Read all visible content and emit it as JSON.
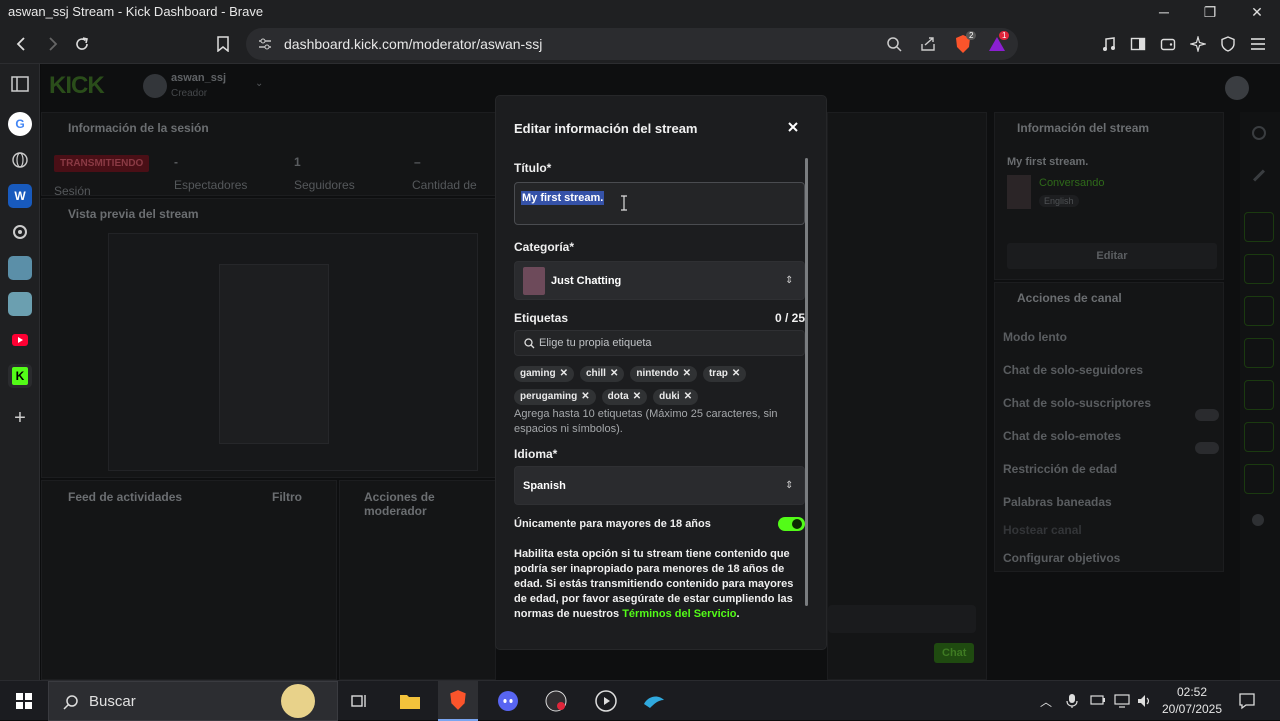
{
  "window": {
    "title": "aswan_ssj Stream - Kick Dashboard - Brave",
    "controls": [
      "─",
      "❐",
      "✕"
    ]
  },
  "browser": {
    "url": "dashboard.kick.com/moderator/aswan-ssj",
    "brave_shield_count": "2",
    "rewards_count": "1"
  },
  "page": {
    "logo": "KICK",
    "user": {
      "name": "aswan_ssj",
      "role": "Creador"
    },
    "session_panel": {
      "title": "Información de la sesión",
      "status": "TRANSMITIENDO",
      "stats": [
        {
          "value": "-",
          "label": "Sesión"
        },
        {
          "value": "-",
          "label": "Espectadores"
        },
        {
          "value": "1",
          "label": "Seguidores"
        },
        {
          "value": "–",
          "label": "Cantidad de"
        }
      ]
    },
    "preview_panel": {
      "title": "Vista previa del stream"
    },
    "activity_panel": {
      "title": "Feed de actividades",
      "filter": "Filtro"
    },
    "mod_actions_panel": {
      "title": "Acciones de moderador"
    },
    "stream_info_panel": {
      "title": "Información del stream",
      "stream_title": "My first stream.",
      "category": "Conversando",
      "language": "English",
      "edit_button": "Editar"
    },
    "channel_actions_panel": {
      "title": "Acciones de canal",
      "items": [
        "Modo lento",
        "Chat de solo-seguidores",
        "Chat de solo-suscriptores",
        "Chat de solo-emotes",
        "Restricción de edad",
        "Palabras baneadas",
        "Hostear canal",
        "Configurar objetivos"
      ]
    },
    "chat": {
      "send_button": "Chat"
    }
  },
  "modal": {
    "title": "Editar información del stream",
    "title_label": "Título*",
    "title_value": "My first stream.",
    "category_label": "Categoría*",
    "category_value": "Just Chatting",
    "tags_label": "Etiquetas",
    "tags_count": "0 / 25",
    "tags_placeholder": "Elige tu propia etiqueta",
    "tags": [
      "gaming",
      "chill",
      "nintendo",
      "trap",
      "perugaming",
      "dota",
      "duki"
    ],
    "tags_help": "Agrega hasta 10 etiquetas (Máximo 25 caracteres, sin espacios ni símbolos).",
    "language_label": "Idioma*",
    "language_value": "Spanish",
    "mature_label": "Únicamente para mayores de 18 años",
    "mature_desc": "Habilita esta opción si tu stream tiene contenido que podría ser inapropiado para menores de 18 años de edad. Si estás transmitiendo contenido para mayores de edad, por favor asegúrate de estar cumpliendo las normas de nuestros",
    "terms_link": "Términos del Servicio",
    "terms_suffix": "."
  },
  "taskbar": {
    "search_label": "Buscar",
    "time": "02:52",
    "date": "20/07/2025"
  },
  "colors": {
    "kick_green": "#53fc18",
    "live_red": "#e0253a",
    "panel": "#1c1d1f"
  }
}
